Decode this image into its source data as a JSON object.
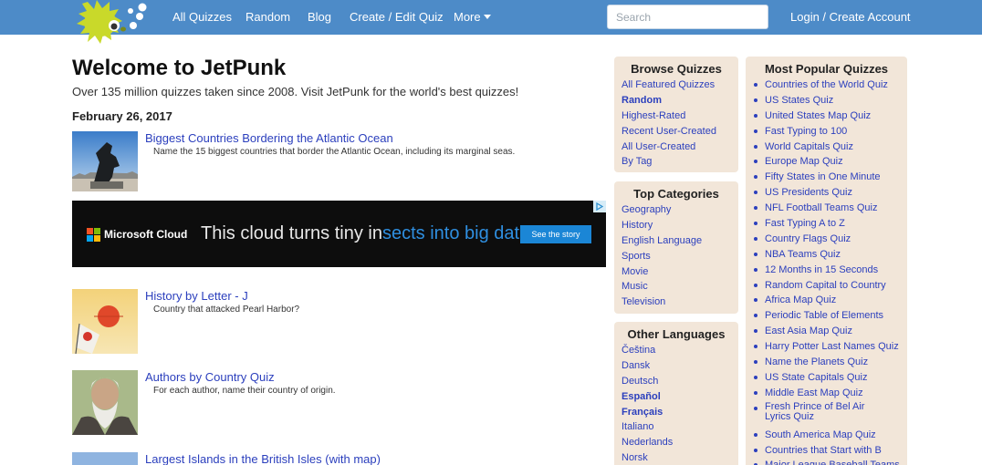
{
  "nav": {
    "items": [
      "All Quizzes",
      "Random",
      "Blog",
      "Create / Edit Quiz",
      "More"
    ],
    "search_placeholder": "Search",
    "login": "Login / Create Account"
  },
  "main": {
    "title": "Welcome to JetPunk",
    "subtitle": "Over 135 million quizzes taken since 2008.  Visit JetPunk for the world's best quizzes!",
    "date": "February 26, 2017",
    "quizzes": [
      {
        "title": "Biggest Countries Bordering the Atlantic Ocean",
        "desc": "Name the 15 biggest countries that border the Atlantic Ocean, including its marginal seas."
      },
      {
        "title": "History by Letter - J",
        "desc": "Country that attacked Pearl Harbor?"
      },
      {
        "title": "Authors by Country Quiz",
        "desc": "For each author, name their country of origin."
      },
      {
        "title": "Largest Islands in the British Isles (with map)",
        "desc": ""
      }
    ]
  },
  "ad": {
    "brand": "Microsoft Cloud",
    "headline_pre": "This cloud turns tiny in",
    "headline_hl": "sects into big data.",
    "cta": "See the story"
  },
  "browse": {
    "title": "Browse Quizzes",
    "items": [
      "All Featured Quizzes",
      "Random",
      "Highest-Rated",
      "Recent User-Created",
      "All User-Created",
      "By Tag"
    ]
  },
  "categories": {
    "title": "Top Categories",
    "items": [
      "Geography",
      "History",
      "English Language",
      "Sports",
      "Movie",
      "Music",
      "Television"
    ]
  },
  "languages": {
    "title": "Other Languages",
    "items": [
      "Čeština",
      "Dansk",
      "Deutsch",
      "Español",
      "Français",
      "Italiano",
      "Nederlands",
      "Norsk"
    ]
  },
  "popular": {
    "title": "Most Popular Quizzes",
    "items": [
      "Countries of the World Quiz",
      "US States Quiz",
      "United States Map Quiz",
      "Fast Typing to 100",
      "World Capitals Quiz",
      "Europe Map Quiz",
      "Fifty States in One Minute",
      "US Presidents Quiz",
      "NFL Football Teams Quiz",
      "Fast Typing A to Z",
      "Country Flags Quiz",
      "NBA Teams Quiz",
      "12 Months in 15 Seconds",
      "Random Capital to Country",
      "Africa Map Quiz",
      "Periodic Table of Elements",
      "East Asia Map Quiz",
      "Harry Potter Last Names Quiz",
      "Name the Planets Quiz",
      "US State Capitals Quiz",
      "Middle East Map Quiz",
      "Fresh Prince of Bel Air Lyrics Quiz",
      "South America Map Quiz",
      "Countries that Start with B",
      "Major League Baseball Teams"
    ]
  },
  "colors": {
    "topbar": "#4d8bc8",
    "link": "#2b3fbd",
    "panel": "#f2e6d9",
    "logo_fish": "#c9d92a"
  }
}
